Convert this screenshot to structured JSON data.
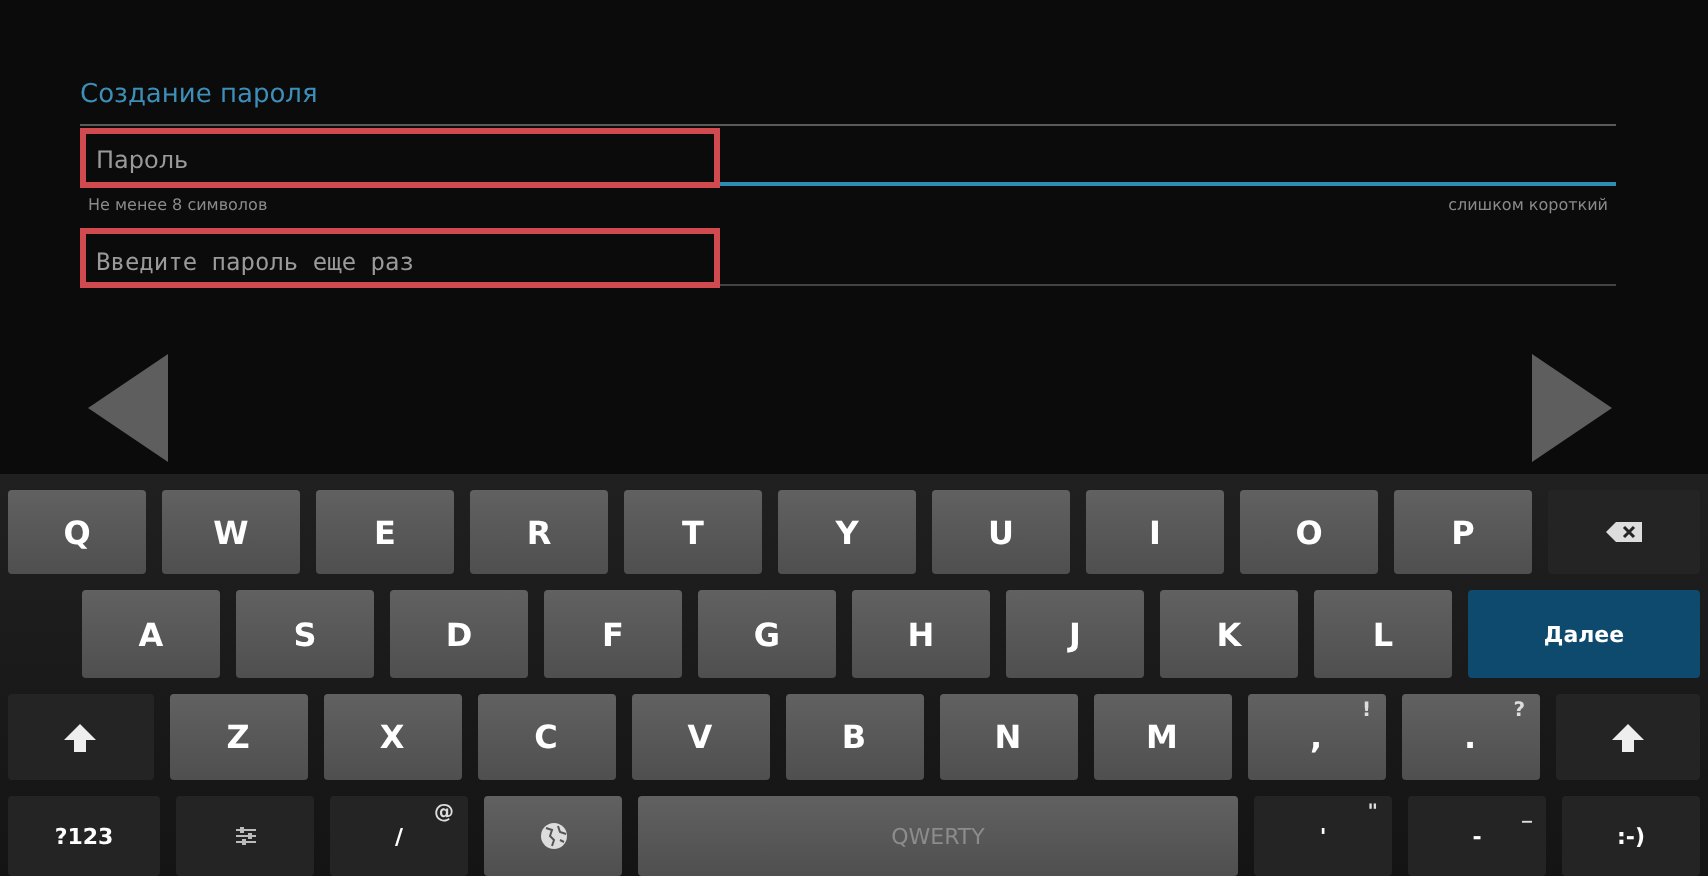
{
  "form": {
    "title": "Создание пароля",
    "fields": [
      {
        "kind": "password",
        "placeholder": "Пароль",
        "focused": true,
        "highlighted": true,
        "hint": "Не менее 8 символов",
        "strength": "слишком короткий"
      },
      {
        "kind": "confirm",
        "placeholder": "Введите пароль еще раз",
        "focused": false,
        "highlighted": true
      }
    ]
  },
  "keyboard": {
    "rows": [
      [
        {
          "kind": "letter",
          "label": "Q"
        },
        {
          "kind": "letter",
          "label": "W"
        },
        {
          "kind": "letter",
          "label": "E"
        },
        {
          "kind": "letter",
          "label": "R"
        },
        {
          "kind": "letter",
          "label": "T"
        },
        {
          "kind": "letter",
          "label": "Y"
        },
        {
          "kind": "letter",
          "label": "U"
        },
        {
          "kind": "letter",
          "label": "I"
        },
        {
          "kind": "letter",
          "label": "O"
        },
        {
          "kind": "letter",
          "label": "P"
        },
        {
          "kind": "backspace"
        }
      ],
      [
        {
          "kind": "letter",
          "label": "A"
        },
        {
          "kind": "letter",
          "label": "S"
        },
        {
          "kind": "letter",
          "label": "D"
        },
        {
          "kind": "letter",
          "label": "F"
        },
        {
          "kind": "letter",
          "label": "G"
        },
        {
          "kind": "letter",
          "label": "H"
        },
        {
          "kind": "letter",
          "label": "J"
        },
        {
          "kind": "letter",
          "label": "K"
        },
        {
          "kind": "letter",
          "label": "L"
        },
        {
          "kind": "action",
          "label": "Далее"
        }
      ],
      [
        {
          "kind": "shift"
        },
        {
          "kind": "letter",
          "label": "Z"
        },
        {
          "kind": "letter",
          "label": "X"
        },
        {
          "kind": "letter",
          "label": "C"
        },
        {
          "kind": "letter",
          "label": "V"
        },
        {
          "kind": "letter",
          "label": "B"
        },
        {
          "kind": "letter",
          "label": "N"
        },
        {
          "kind": "letter",
          "label": "M"
        },
        {
          "kind": "letter",
          "label": ",",
          "sub": "!"
        },
        {
          "kind": "letter",
          "label": ".",
          "sub": "?"
        },
        {
          "kind": "shift"
        }
      ],
      [
        {
          "kind": "function",
          "label": "?123"
        },
        {
          "kind": "settings"
        },
        {
          "kind": "function",
          "label": "/",
          "sub": "@"
        },
        {
          "kind": "globe"
        },
        {
          "kind": "space",
          "label": "QWERTY"
        },
        {
          "kind": "function",
          "label": "'",
          "sub": "\""
        },
        {
          "kind": "function",
          "label": "-",
          "sub": "_"
        },
        {
          "kind": "function",
          "label": ":-)"
        }
      ]
    ]
  }
}
